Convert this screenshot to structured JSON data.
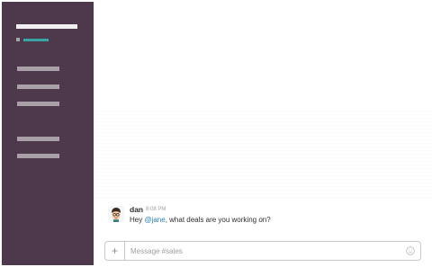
{
  "sidebar": {
    "team_name": "",
    "items": [
      "",
      "",
      "",
      "",
      "",
      ""
    ]
  },
  "message": {
    "author": "dan",
    "time": "8:08 PM",
    "text_before": "Hey ",
    "mention": "@jane",
    "text_after": ", what deals are you working on?"
  },
  "composer": {
    "placeholder": "Message #sales",
    "value": "",
    "add_icon": "plus-icon",
    "emoji_icon": "smiley-icon"
  },
  "colors": {
    "sidebar_bg": "#4d394b",
    "presence": "#3aa3a3",
    "mention": "#2a80b9"
  }
}
